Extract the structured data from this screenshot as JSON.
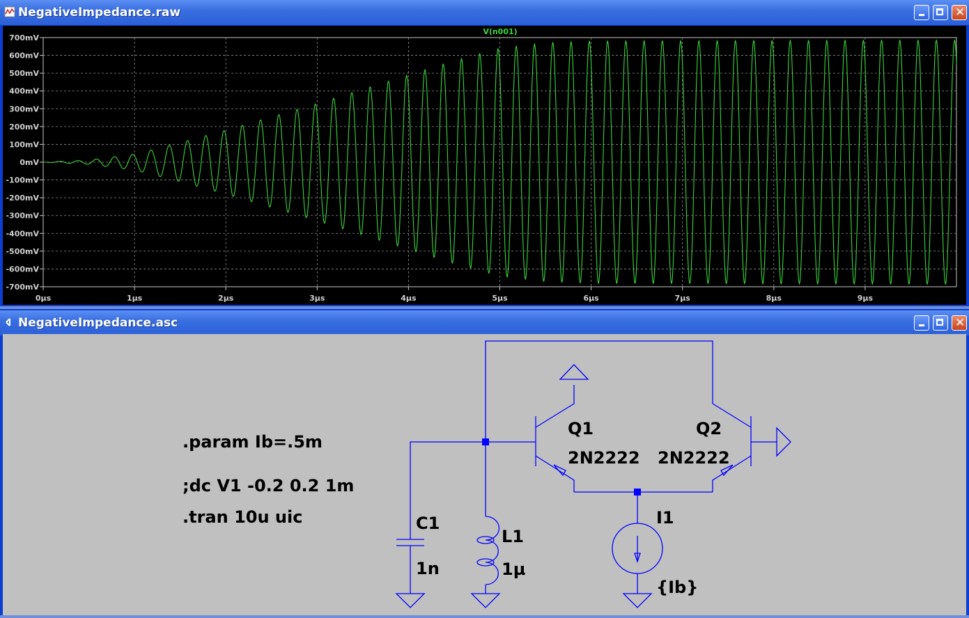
{
  "waveform_window": {
    "title": "NegativeImpedance.raw",
    "icon": "waveform-icon",
    "buttons": [
      "minimize-icon",
      "maximize-icon",
      "close-icon"
    ]
  },
  "schematic_window": {
    "title": "NegativeImpedance.asc",
    "icon": "schematic-icon",
    "buttons": [
      "minimize-icon",
      "maximize-icon",
      "close-icon"
    ]
  },
  "chart_data": {
    "type": "line",
    "title": "V(n001)",
    "xlabel": "",
    "ylabel": "",
    "x_unit": "µs",
    "y_unit": "mV",
    "xlim": [
      0,
      10
    ],
    "ylim": [
      -700,
      700
    ],
    "x_ticks": [
      "0µs",
      "1µs",
      "2µs",
      "3µs",
      "4µs",
      "5µs",
      "6µs",
      "7µs",
      "8µs",
      "9µs"
    ],
    "y_ticks": [
      "700mV",
      "600mV",
      "500mV",
      "400mV",
      "300mV",
      "200mV",
      "100mV",
      "0mV",
      "-100mV",
      "-200mV",
      "-300mV",
      "-400mV",
      "-500mV",
      "-600mV",
      "-700mV"
    ],
    "grid": true,
    "series_color": "#3cd43c",
    "oscillation_period_us": 0.2,
    "first_peak_us": 0.98,
    "envelope": {
      "t_us": [
        0,
        0.5,
        1,
        1.5,
        2,
        2.5,
        3,
        3.5,
        4,
        4.5,
        5,
        5.5,
        6,
        10
      ],
      "amplitude_mV": [
        0,
        12,
        45,
        110,
        180,
        255,
        330,
        410,
        490,
        570,
        640,
        670,
        680,
        685
      ]
    }
  },
  "schematic": {
    "directives": [
      ".param Ib=.5m",
      ";dc V1 -0.2 0.2 1m",
      ".tran 10u uic"
    ],
    "components": {
      "q1": {
        "ref": "Q1",
        "value": "2N2222"
      },
      "q2": {
        "ref": "Q2",
        "value": "2N2222"
      },
      "c1": {
        "ref": "C1",
        "value": "1n"
      },
      "l1": {
        "ref": "L1",
        "value": "1µ"
      },
      "i1": {
        "ref": "I1",
        "value": "{Ib}"
      }
    },
    "wire_color": "#0000ff"
  }
}
